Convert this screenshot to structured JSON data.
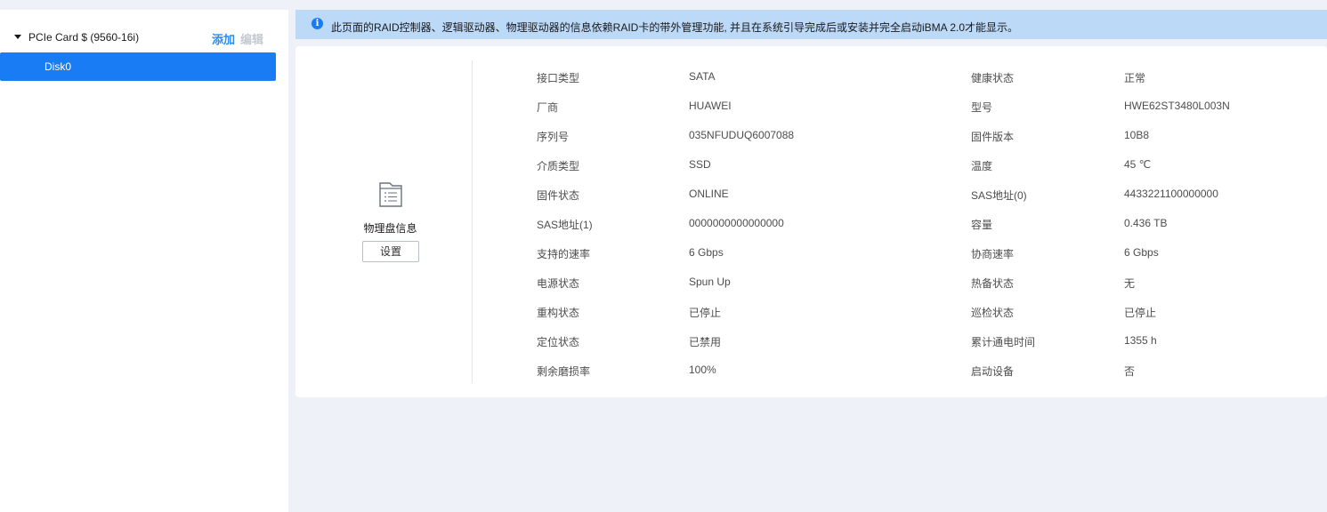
{
  "sidebar": {
    "root_label": "PCIe Card $ (9560-16i)",
    "add_label": "添加",
    "edit_label": "编辑",
    "child_label": "Disk0"
  },
  "notice": {
    "text": "此页面的RAID控制器、逻辑驱动器、物理驱动器的信息依赖RAID卡的带外管理功能, 并且在系统引导完成后或安装并完全启动iBMA 2.0才能显示。"
  },
  "panel": {
    "title": "物理盘信息",
    "setting_label": "设置",
    "rows": [
      {
        "k1": "接口类型",
        "v1": "SATA",
        "k2": "健康状态",
        "v2": "正常"
      },
      {
        "k1": "厂商",
        "v1": "HUAWEI",
        "k2": "型号",
        "v2": "HWE62ST3480L003N"
      },
      {
        "k1": "序列号",
        "v1": "035NFUDUQ6007088",
        "k2": "固件版本",
        "v2": "10B8"
      },
      {
        "k1": "介质类型",
        "v1": "SSD",
        "k2": "温度",
        "v2": "45 ℃"
      },
      {
        "k1": "固件状态",
        "v1": "ONLINE",
        "k2": "SAS地址(0)",
        "v2": "4433221100000000"
      },
      {
        "k1": "SAS地址(1)",
        "v1": "0000000000000000",
        "k2": "容量",
        "v2": "0.436 TB"
      },
      {
        "k1": "支持的速率",
        "v1": "6 Gbps",
        "k2": "协商速率",
        "v2": "6 Gbps"
      },
      {
        "k1": "电源状态",
        "v1": "Spun Up",
        "k2": "热备状态",
        "v2": "无"
      },
      {
        "k1": "重构状态",
        "v1": "已停止",
        "k2": "巡检状态",
        "v2": "已停止"
      },
      {
        "k1": "定位状态",
        "v1": "已禁用",
        "k2": "累计通电时间",
        "v2": "1355 h"
      },
      {
        "k1": "剩余磨损率",
        "v1": "100%",
        "k2": "启动设备",
        "v2": "否"
      }
    ]
  }
}
